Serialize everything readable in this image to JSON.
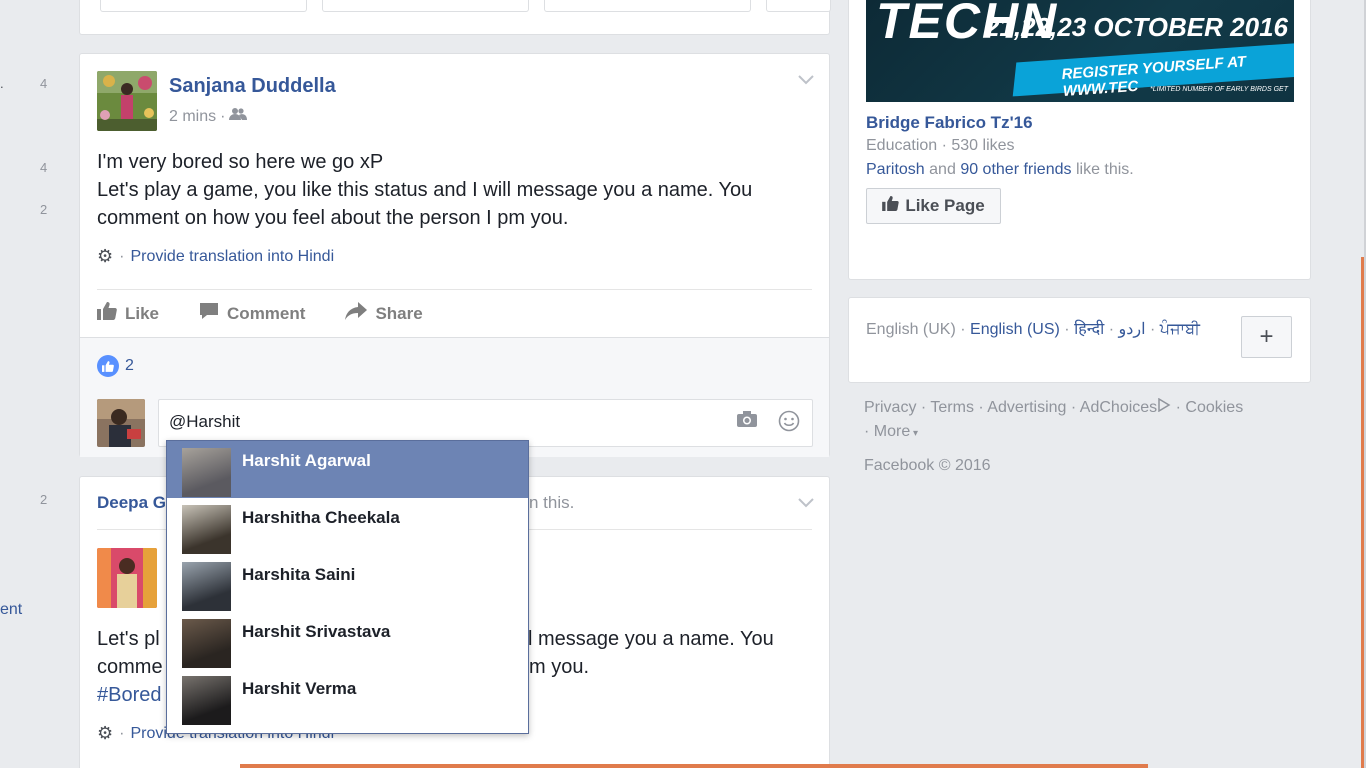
{
  "left_column": {
    "counts": [
      "4",
      "4",
      "2",
      "2"
    ],
    "partial_link": "ent"
  },
  "post1": {
    "author": "Sanjana Duddella",
    "time": "2 mins",
    "privacy_sep": "·",
    "text_line1": "I'm very bored so here we go xP",
    "text_line2": "Let's play a game, you like this status and I will message you a name. You",
    "text_line3": "comment on how you feel about the person I pm you.",
    "translate_label": "Provide translation into Hindi",
    "actions": {
      "like": "Like",
      "comment": "Comment",
      "share": "Share"
    },
    "like_count": "2",
    "comment_input_value": "@Harshit"
  },
  "mention_suggestions": [
    {
      "name": "Harshit Agarwal",
      "color_a": "#5b5a60",
      "color_b": "#a7a29b"
    },
    {
      "name": "Harshitha Cheekala",
      "color_a": "#3b342c",
      "color_b": "#c8c3b8"
    },
    {
      "name": "Harshita Saini",
      "color_a": "#2d3138",
      "color_b": "#9aa4ae"
    },
    {
      "name": "Harshit Srivastava",
      "color_a": "#2a2521",
      "color_b": "#6b5a4b"
    },
    {
      "name": "Harshit Verma",
      "color_a": "#1c1b1c",
      "color_b": "#78736e"
    }
  ],
  "post2": {
    "header_name": "Deepa G",
    "header_rest": "n this.",
    "text_line1_start": "Let's pl",
    "text_line1_end": "l message you a name. You",
    "text_line2_start": "comme",
    "text_line2_end": "m you.",
    "hashtag": "#Bored",
    "translate_label": "Provide translation into Hindi"
  },
  "ad": {
    "banner_title": "TECHN",
    "banner_date": "21,22,23 OCTOBER 2016",
    "banner_register": "REGISTER YOURSELF AT WWW.TEC",
    "banner_fine": "*LIMITED NUMBER OF EARLY BIRDS GET",
    "page_name": "Bridge Fabrico Tz'16",
    "page_meta": "Education · 530 likes",
    "friend_name": "Paritosh",
    "friends_mid": "and",
    "friends_count": "90 other friends",
    "friends_end": "like this.",
    "like_page_label": "Like Page"
  },
  "languages": {
    "lang1": "English (UK)",
    "lang2": "English (US)",
    "lang3": "हिन्दी",
    "lang4": "اردو",
    "lang5": "ਪੰਜਾਬੀ",
    "plus": "+"
  },
  "footer": {
    "privacy": "Privacy",
    "terms": "Terms",
    "advertising": "Advertising",
    "adchoices": "AdChoices",
    "cookies": "Cookies",
    "more": "More",
    "copyright": "Facebook © 2016"
  },
  "colors": {
    "link": "#365899",
    "selected_row": "#6d84b4",
    "accent_line": "#e07b4c"
  }
}
